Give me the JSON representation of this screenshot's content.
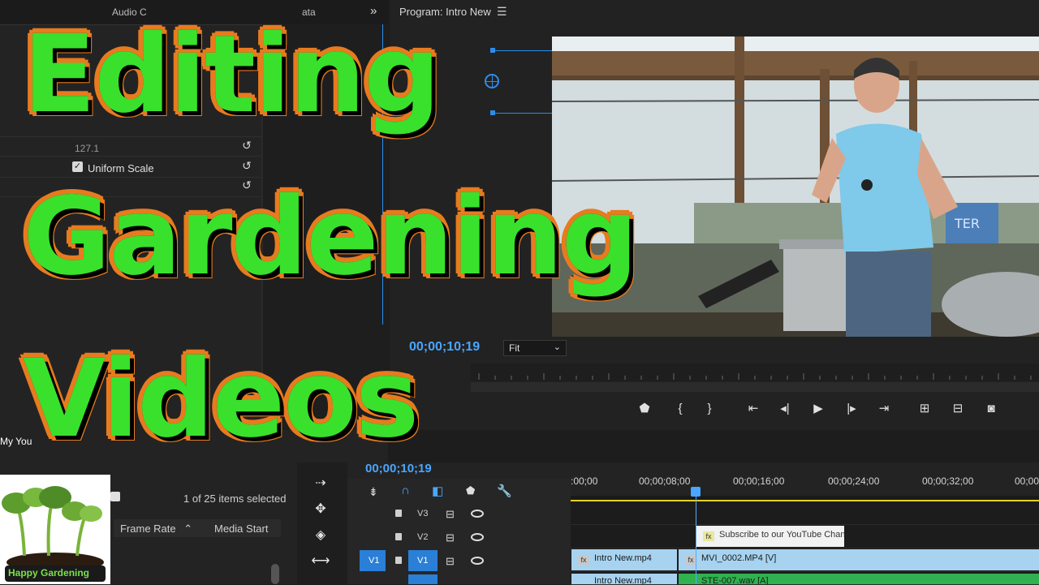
{
  "overlay": {
    "line1": "Editing",
    "line2": "Gardening",
    "line3": "Videos"
  },
  "effect_controls": {
    "tabs_text": "Audio C",
    "tab_meta": "ata",
    "value_scale": "127.1",
    "uniform_scale_label": "Uniform Scale",
    "uniform_scale_checked": true
  },
  "program_monitor": {
    "title": "Program: Intro New",
    "timecode": "00;00;10;19",
    "zoom": "Fit"
  },
  "project": {
    "tab_label": "My You",
    "items_selected": "1 of 25 items selected",
    "columns": [
      "Frame Rate",
      "Media Start"
    ],
    "thumb_label": "Happy Gardening"
  },
  "timeline": {
    "timecode": "00;00;10;19",
    "ticks": [
      ":00;00",
      "00;00;08;00",
      "00;00;16;00",
      "00;00;24;00",
      "00;00;32;00",
      "00;00"
    ],
    "tracks": [
      {
        "name": "V3"
      },
      {
        "name": "V2"
      },
      {
        "name": "V1",
        "source": "V1"
      }
    ],
    "clips": {
      "v2_title": "Subscribe to our YouTube Chann",
      "v1_a": "Intro New.mp4",
      "v1_b": "MVI_0002.MP4 [V]",
      "a1_a": "Intro New.mp4",
      "a1_b": "STE-007.wav [A]"
    }
  },
  "colors": {
    "accent_blue": "#4aa6ff",
    "title_green": "#39e12c",
    "title_orange": "#e87b1e"
  }
}
